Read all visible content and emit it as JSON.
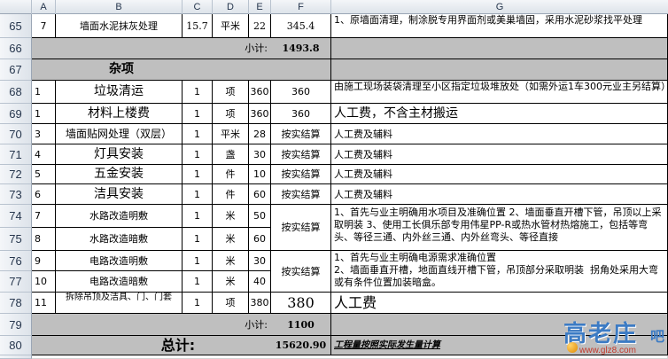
{
  "columns": [
    "A",
    "B",
    "C",
    "D",
    "E",
    "F",
    "G"
  ],
  "rows": [
    {
      "num": "65",
      "a": "7",
      "b": "墙面水泥抹灰处理",
      "c": "15.7",
      "d": "平米",
      "e": "22",
      "f": "345.4",
      "g": "1、原墙面清理，制涂脱专用界面剂或美巢墙固，采用水泥砂浆找平处理"
    },
    {
      "num": "66",
      "label": "小计:",
      "value": "1493.8"
    },
    {
      "num": "67",
      "title": "杂项"
    },
    {
      "num": "68",
      "a": "1",
      "b": "垃圾清运",
      "c": "1",
      "d": "项",
      "e": "360",
      "f": "360",
      "g": "由施工现场装袋清理至小区指定垃圾堆放处（如需外运1车300元业主另结算）"
    },
    {
      "num": "69",
      "a": "1",
      "b": "材料上楼费",
      "c": "1",
      "d": "项",
      "e": "360",
      "f": "360",
      "g": "人工费，不含主材搬运"
    },
    {
      "num": "70",
      "a": "3",
      "b": "墙面贴网处理（双层）",
      "c": "1",
      "d": "平米",
      "e": "28",
      "f": "按实结算",
      "g": "人工费及辅料"
    },
    {
      "num": "71",
      "a": "4",
      "b": "灯具安装",
      "c": "1",
      "d": "盏",
      "e": "30",
      "f": "按实结算",
      "g": "人工费及辅料"
    },
    {
      "num": "72",
      "a": "5",
      "b": "五金安装",
      "c": "1",
      "d": "件",
      "e": "10",
      "f": "按实结算",
      "g": "人工费及辅料"
    },
    {
      "num": "73",
      "a": "6",
      "b": "洁具安装",
      "c": "1",
      "d": "件",
      "e": "60",
      "f": "按实结算",
      "g": "人工费及辅料"
    },
    {
      "num": "74",
      "a": "7",
      "b": "水路改造明敷",
      "c": "1",
      "d": "米",
      "e": "50"
    },
    {
      "num": "75",
      "a": "8",
      "b": "水路改造暗敷",
      "c": "1",
      "d": "米",
      "e": "60"
    },
    {
      "num": "76",
      "a": "9",
      "b": "电路改造明敷",
      "c": "1",
      "d": "米",
      "e": "30"
    },
    {
      "num": "77",
      "a": "10",
      "b": "电路改造暗敷",
      "c": "1",
      "d": "米",
      "e": "40"
    },
    {
      "num": "78",
      "a": "11",
      "b": "拆除吊顶及洁具、门、门套",
      "c": "1",
      "d": "项",
      "e": "380",
      "f": "380",
      "g": "人工费"
    },
    {
      "num": "79",
      "label": "小计:",
      "value": "1100"
    },
    {
      "num": "80",
      "label": "总计:",
      "value": "15620.90",
      "note": "工程量按照实际发生量计算"
    },
    {
      "num": "81"
    }
  ],
  "water_merged": {
    "f": "按实结算",
    "g": "1、首先与业主明确用水项目及准确位置  2、墙面垂直开槽下管，吊顶以上采取明装 3、使用工长俱乐部专用伟星PP-R或热水管材热熔施工，包括等弯头、等径三通、内外丝三通、内外丝弯头、等径直接"
  },
  "elec_merged": {
    "f": "按实结算",
    "g": "1、首先与业主明确电源需求准确位置\n2、墙面垂直开槽，地面直线开槽下管，吊顶部分采取明装  拐角处采用大弯或有条件位置加装暗盒。"
  },
  "watermark": {
    "chars": "高老庄",
    "suffix": "吧",
    "url": "www.glz8.com"
  }
}
